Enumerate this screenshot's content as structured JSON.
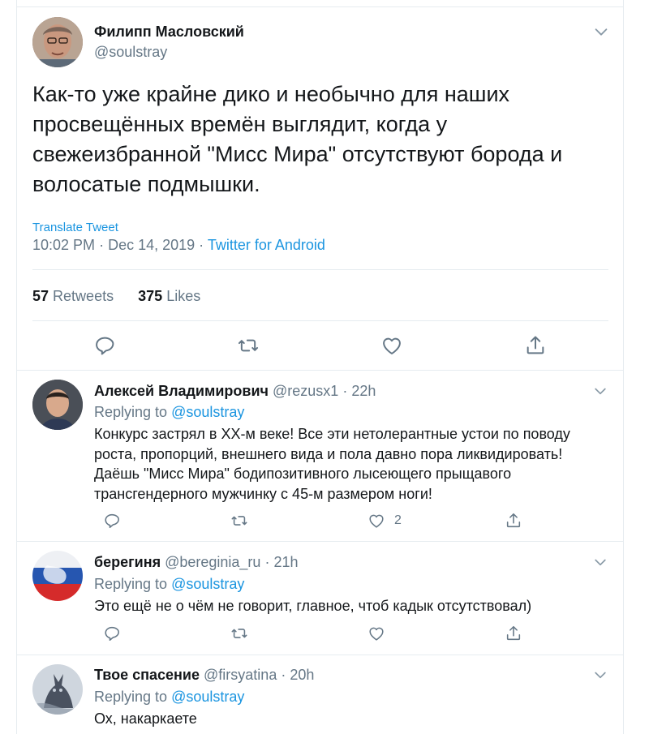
{
  "main_tweet": {
    "author_name": "Филипп Масловский",
    "author_handle": "@soulstray",
    "text": "Как-то уже крайне дико и необычно для наших просвещённых времён выглядит, когда у свежеизбранной \"Мисс Мира\" отсутствуют борода и волосатые подмышки.",
    "translate_label": "Translate Tweet",
    "time": "10:02 PM",
    "date": "Dec 14, 2019",
    "meta_separator": "·",
    "source": "Twitter for Android",
    "retweets_count": "57",
    "retweets_label": "Retweets",
    "likes_count": "375",
    "likes_label": "Likes"
  },
  "replies": [
    {
      "name": "Алексей Владимирович",
      "handle": "@rezusx1",
      "sep": "·",
      "age": "22h",
      "replying_label": "Replying to",
      "replying_handle": "@soulstray",
      "text": "Конкурс застрял в ХХ-м веке! Все эти нетолерантные устои по поводу роста, пропорций, внешнего вида и пола давно пора ликвидировать! Даёшь \"Мисс Мира\" бодипозитивного лысеющего прыщавого трансгендерного мужчинку с 45-м размером ноги!",
      "like_count": "2"
    },
    {
      "name": "берегиня",
      "handle": "@bereginia_ru",
      "sep": "·",
      "age": "21h",
      "replying_label": "Replying to",
      "replying_handle": "@soulstray",
      "text": "Это ещё не о чём не говорит, главное, чтоб кадык отсутствовал)",
      "like_count": ""
    },
    {
      "name": "Твое спасение",
      "handle": "@firsyatina",
      "sep": "·",
      "age": "20h",
      "replying_label": "Replying to",
      "replying_handle": "@soulstray",
      "text": "Ох, накаркаете",
      "like_count": ""
    }
  ],
  "icons": [
    "chevron-down-icon",
    "reply-icon",
    "retweet-icon",
    "like-icon",
    "share-icon"
  ],
  "colors": {
    "link": "#1b95e0",
    "muted": "#657786",
    "icon": "#657786",
    "border": "#e6ecf0"
  }
}
